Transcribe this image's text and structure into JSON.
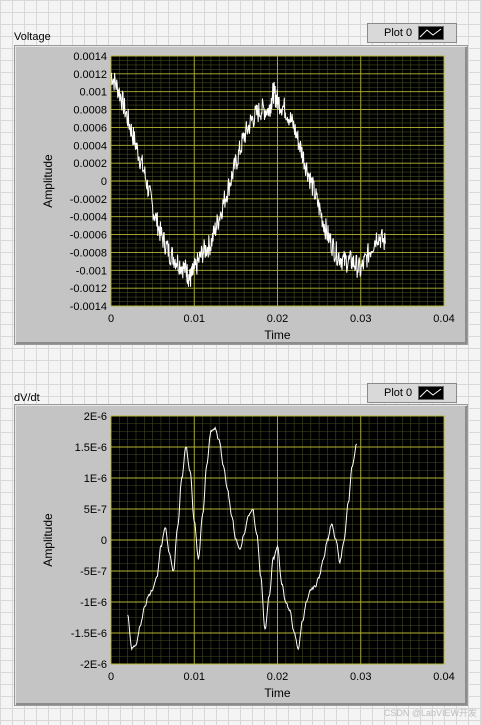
{
  "graphs": [
    {
      "label": "Voltage",
      "legend": {
        "plot_name": "Plot 0"
      },
      "chart_data": {
        "type": "line",
        "xlabel": "Time",
        "ylabel": "Amplitude",
        "xlim": [
          0,
          0.04
        ],
        "ylim": [
          -0.0014,
          0.0014
        ],
        "x_ticks": [
          0,
          0.01,
          0.02,
          0.03,
          0.04
        ],
        "x_tick_labels": [
          "0",
          "0.01",
          "0.02",
          "0.03",
          "0.04"
        ],
        "y_ticks": [
          0.0014,
          0.0012,
          0.001,
          0.0008,
          0.0006,
          0.0004,
          0.0002,
          0,
          -0.0002,
          -0.0004,
          -0.0006,
          -0.0008,
          -0.001,
          -0.0012,
          -0.0014
        ],
        "y_tick_labels": [
          "0.0014",
          "0.0012",
          "0.001",
          "0.0008",
          "0.0006",
          "0.0004",
          "0.0002",
          "0",
          "-0.0002",
          "-0.0004",
          "-0.0006",
          "-0.0008",
          "-0.001",
          "-0.0012",
          "-0.0014"
        ],
        "grid": true,
        "series": [
          {
            "color": "#ffffff",
            "x": [
              0,
              0.001,
              0.002,
              0.003,
              0.004,
              0.005,
              0.006,
              0.007,
              0.008,
              0.009,
              0.0095,
              0.01,
              0.011,
              0.012,
              0.013,
              0.014,
              0.015,
              0.016,
              0.017,
              0.018,
              0.019,
              0.0195,
              0.02,
              0.021,
              0.022,
              0.023,
              0.024,
              0.025,
              0.026,
              0.027,
              0.028,
              0.029,
              0.03,
              0.031,
              0.032,
              0.033
            ],
            "y": [
              0.0012,
              0.001,
              0.0007,
              0.0004,
              0.0001,
              -0.0003,
              -0.0006,
              -0.0008,
              -0.0009,
              -0.001,
              -0.0011,
              -0.001,
              -0.0008,
              -0.0007,
              -0.0004,
              -0.0001,
              0.0002,
              0.0005,
              0.0007,
              0.0008,
              0.0008,
              0.001,
              0.0009,
              0.0008,
              0.0006,
              0.0003,
              0.0,
              -0.0003,
              -0.0006,
              -0.0008,
              -0.0009,
              -0.0009,
              -0.001,
              -0.0008,
              -0.0006,
              -0.0007
            ]
          }
        ]
      }
    },
    {
      "label": "dV/dt",
      "legend": {
        "plot_name": "Plot 0"
      },
      "chart_data": {
        "type": "line",
        "xlabel": "Time",
        "ylabel": "Amplitude",
        "xlim": [
          0,
          0.04
        ],
        "ylim": [
          -2e-06,
          2e-06
        ],
        "x_ticks": [
          0,
          0.01,
          0.02,
          0.03,
          0.04
        ],
        "x_tick_labels": [
          "0",
          "0.01",
          "0.02",
          "0.03",
          "0.04"
        ],
        "y_ticks": [
          2e-06,
          1.5e-06,
          1e-06,
          5e-07,
          0,
          -5e-07,
          -1e-06,
          -1.5e-06,
          -2e-06
        ],
        "y_tick_labels": [
          "2E-6",
          "1.5E-6",
          "1E-6",
          "5E-7",
          "0",
          "-5E-7",
          "-1E-6",
          "-1.5E-6",
          "-2E-6"
        ],
        "grid": true,
        "series": [
          {
            "color": "#ffffff",
            "x": [
              0.002,
              0.0025,
              0.003,
              0.0035,
              0.004,
              0.0045,
              0.005,
              0.0055,
              0.006,
              0.0065,
              0.007,
              0.0075,
              0.008,
              0.0085,
              0.009,
              0.0095,
              0.01,
              0.0105,
              0.011,
              0.0115,
              0.012,
              0.0125,
              0.013,
              0.0135,
              0.014,
              0.0145,
              0.015,
              0.0155,
              0.016,
              0.0165,
              0.017,
              0.0175,
              0.018,
              0.0185,
              0.019,
              0.0195,
              0.02,
              0.0205,
              0.021,
              0.0215,
              0.022,
              0.0225,
              0.023,
              0.0235,
              0.024,
              0.0245,
              0.025,
              0.0255,
              0.026,
              0.0265,
              0.027,
              0.0275,
              0.028,
              0.0285,
              0.029,
              0.0295
            ],
            "y": [
              -1.2e-06,
              -1.75e-06,
              -1.7e-06,
              -1.4e-06,
              -1.1e-06,
              -9e-07,
              -8e-07,
              -6e-07,
              -1e-07,
              2e-07,
              -2e-07,
              -5e-07,
              2e-07,
              1e-06,
              1.5e-06,
              1.1e-06,
              3e-07,
              -3e-07,
              4e-07,
              1.2e-06,
              1.75e-06,
              1.8e-06,
              1.6e-06,
              1.2e-06,
              8e-07,
              4e-07,
              0.0,
              -1.5e-07,
              1e-07,
              4e-07,
              5e-07,
              1e-07,
              -6e-07,
              -1.45e-06,
              -9e-07,
              -3e-07,
              -1e-07,
              -7e-07,
              -1e-06,
              -1.15e-06,
              -1.5e-06,
              -1.75e-06,
              -1.3e-06,
              -1e-06,
              -8e-07,
              -7.5e-07,
              -6e-07,
              -3e-07,
              0.0,
              2.5e-07,
              0.0,
              -3.5e-07,
              0.0,
              6e-07,
              1.2e-06,
              1.55e-06
            ]
          }
        ]
      }
    }
  ],
  "watermark": "CSDN @LabVIEW开发"
}
